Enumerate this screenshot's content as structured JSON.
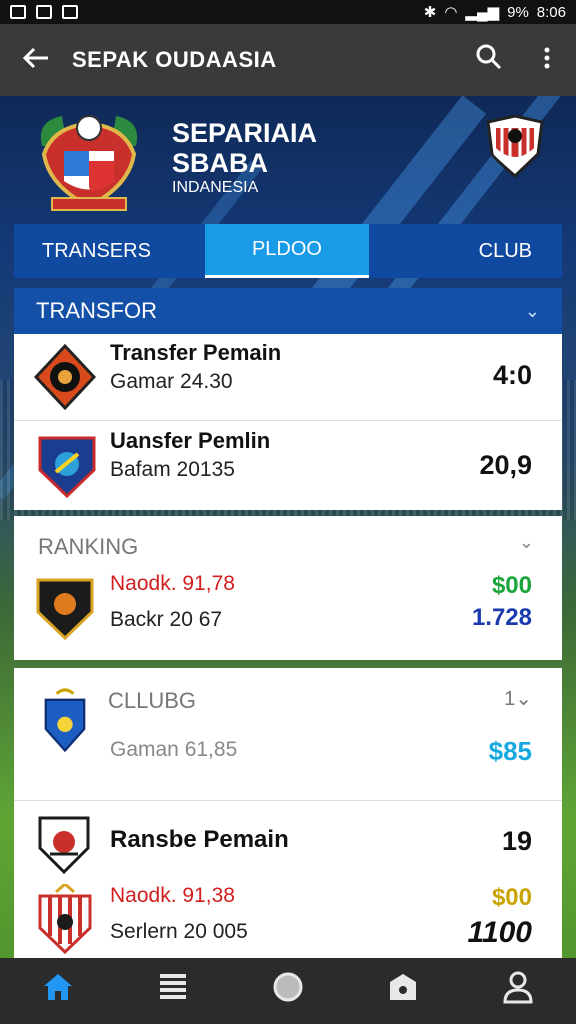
{
  "status_bar": {
    "battery": "9%",
    "time": "8:06"
  },
  "app_bar": {
    "title": "SEPAK OUDAASIA",
    "back_icon": "arrow-left-icon",
    "search_icon": "search-icon",
    "menu_icon": "more-vert-icon"
  },
  "hero": {
    "line1": "SEPARIAIA",
    "line2": "SBABA",
    "line3": "INDANESIA"
  },
  "tabs": [
    {
      "label": "TRANSERS"
    },
    {
      "label": "PLDOO",
      "active": true
    },
    {
      "label": "CLUB"
    }
  ],
  "transfer_section": {
    "title": "TRANSFOR",
    "rows": [
      {
        "title": "Transfer Pemain",
        "subtitle": "Gamar 24.30",
        "value": "4:0"
      },
      {
        "title": "Uansfer Pemlin",
        "subtitle": "Bafam 20135",
        "value": "20,9"
      }
    ]
  },
  "ranking_section": {
    "title": "RANKING",
    "row": {
      "line1": "Naodk. 91,78",
      "line2": "Backr 20 67",
      "value1": "$00",
      "value2": "1.728"
    }
  },
  "club_section": {
    "title": "CLLUBG",
    "badge": "1",
    "row": {
      "subtitle": "Gaman 61,85",
      "value": "$85"
    }
  },
  "bottom_section": {
    "row1": {
      "title": "Ransbe Pemain",
      "value": "19"
    },
    "row2": {
      "line1": "Naodk. 91,38",
      "line2": "Serlern 20 005",
      "value1": "$00",
      "value2": "1100"
    }
  },
  "colors": {
    "accent": "#1a9be8",
    "red": "#d11f1f",
    "green": "#19a53a",
    "blue": "#1a3bb0",
    "yellow": "#c9a400",
    "cyan": "#16a9e0"
  },
  "bottom_nav": [
    {
      "icon": "home-icon",
      "active": true
    },
    {
      "icon": "list-icon"
    },
    {
      "icon": "circle-icon"
    },
    {
      "icon": "shield-lock-icon"
    },
    {
      "icon": "profile-icon"
    }
  ]
}
